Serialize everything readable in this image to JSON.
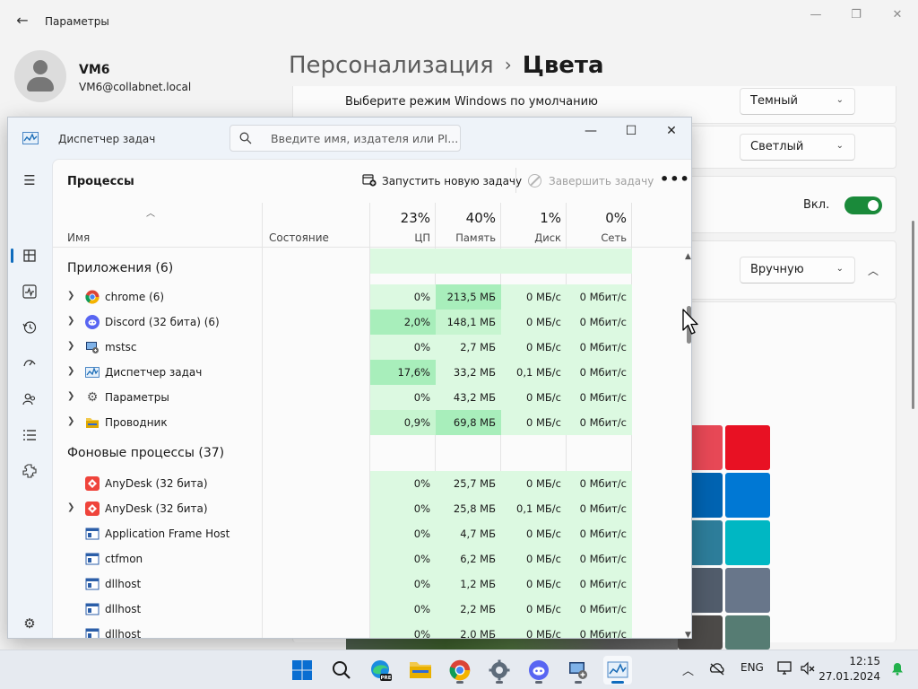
{
  "settings": {
    "title": "Параметры",
    "user": {
      "name": "VM6",
      "email": "VM6@collabnet.local"
    },
    "breadcrumb": {
      "parent": "Персонализация",
      "separator": "›",
      "current": "Цвета"
    },
    "mode_label": "Выберите режим Windows по умолчанию",
    "windows_mode": "Темный",
    "app_mode": "Светлый",
    "transparency_label": "Вкл.",
    "accent_mode": "Вручную",
    "swatch_colors": [
      "#e74856",
      "#e81123",
      "#0063b1",
      "#0078d4",
      "#2d7d9a",
      "#00b7c3",
      "#515c6b",
      "#68768a",
      "#4c4a48",
      "#567c73"
    ]
  },
  "taskmgr": {
    "title": "Диспетчер задач",
    "search_placeholder": "Введите имя, издателя или PI...",
    "heading": "Процессы",
    "run_task": "Запустить новую задачу",
    "end_task": "Завершить задачу",
    "more": "•••",
    "columns": {
      "name": "Имя",
      "state": "Состояние",
      "cpu_pct": "23%",
      "cpu": "ЦП",
      "mem_pct": "40%",
      "mem": "Память",
      "disk_pct": "1%",
      "disk": "Диск",
      "net_pct": "0%",
      "net": "Сеть"
    },
    "groups": {
      "apps": "Приложения (6)",
      "background": "Фоновые процессы (37)"
    },
    "apps": [
      {
        "name": "chrome (6)",
        "cpu": "0%",
        "mem": "213,5 МБ",
        "disk": "0 МБ/с",
        "net": "0 Мбит/с"
      },
      {
        "name": "Discord (32 бита) (6)",
        "cpu": "2,0%",
        "mem": "148,1 МБ",
        "disk": "0 МБ/с",
        "net": "0 Мбит/с"
      },
      {
        "name": "mstsc",
        "cpu": "0%",
        "mem": "2,7 МБ",
        "disk": "0 МБ/с",
        "net": "0 Мбит/с"
      },
      {
        "name": "Диспетчер задач",
        "cpu": "17,6%",
        "mem": "33,2 МБ",
        "disk": "0,1 МБ/с",
        "net": "0 Мбит/с"
      },
      {
        "name": "Параметры",
        "cpu": "0%",
        "mem": "43,2 МБ",
        "disk": "0 МБ/с",
        "net": "0 Мбит/с"
      },
      {
        "name": "Проводник",
        "cpu": "0,9%",
        "mem": "69,8 МБ",
        "disk": "0 МБ/с",
        "net": "0 Мбит/с"
      }
    ],
    "background": [
      {
        "name": "AnyDesk (32 бита)",
        "cpu": "0%",
        "mem": "25,7 МБ",
        "disk": "0 МБ/с",
        "net": "0 Мбит/с"
      },
      {
        "name": "AnyDesk (32 бита)",
        "cpu": "0%",
        "mem": "25,8 МБ",
        "disk": "0,1 МБ/с",
        "net": "0 Мбит/с"
      },
      {
        "name": "Application Frame Host",
        "cpu": "0%",
        "mem": "4,7 МБ",
        "disk": "0 МБ/с",
        "net": "0 Мбит/с"
      },
      {
        "name": "ctfmon",
        "cpu": "0%",
        "mem": "6,2 МБ",
        "disk": "0 МБ/с",
        "net": "0 Мбит/с"
      },
      {
        "name": "dllhost",
        "cpu": "0%",
        "mem": "1,2 МБ",
        "disk": "0 МБ/с",
        "net": "0 Мбит/с"
      },
      {
        "name": "dllhost",
        "cpu": "0%",
        "mem": "2,2 МБ",
        "disk": "0 МБ/с",
        "net": "0 Мбит/с"
      },
      {
        "name": "dllhost",
        "cpu": "0%",
        "mem": "2,0 МБ",
        "disk": "0 МБ/с",
        "net": "0 Мбит/с"
      }
    ]
  },
  "taskbar": {
    "language": "ENG",
    "time": "12:15",
    "date": "27.01.2024"
  }
}
